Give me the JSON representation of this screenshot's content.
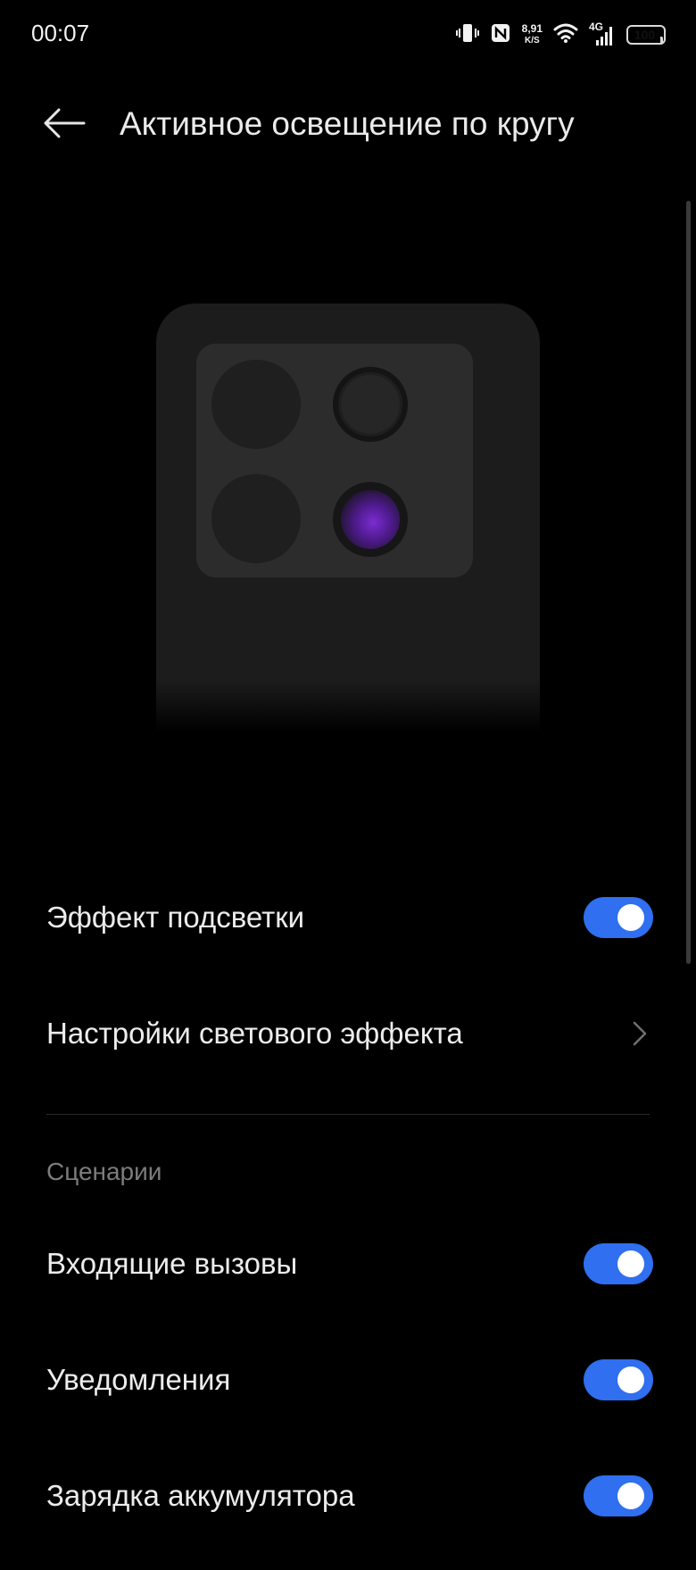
{
  "status_bar": {
    "time": "00:07",
    "net_speed_value": "8,91",
    "net_speed_unit": "K/S",
    "network_type": "4G",
    "battery_level": "100",
    "icons": [
      "vibrate-icon",
      "nfc-icon",
      "wifi-icon",
      "cellular-signal-icon",
      "battery-icon"
    ]
  },
  "header": {
    "title": "Активное освещение по кругу",
    "back_icon": "arrow-left-icon"
  },
  "preview": {
    "lens_glow_color": "#7b2cd1"
  },
  "settings": {
    "lighting_effect": {
      "label": "Эффект подсветки",
      "enabled": true
    },
    "light_effect_settings": {
      "label": "Настройки светового эффекта",
      "icon": "chevron-right-icon"
    }
  },
  "scenarios": {
    "section_title": "Сценарии",
    "items": [
      {
        "label": "Входящие вызовы",
        "enabled": true
      },
      {
        "label": "Уведомления",
        "enabled": true
      },
      {
        "label": "Зарядка аккумулятора",
        "enabled": true
      }
    ]
  },
  "colors": {
    "background": "#000000",
    "toggle_on": "#2f6ff0",
    "text_primary": "#ececec",
    "text_secondary": "#7c7c7c"
  }
}
